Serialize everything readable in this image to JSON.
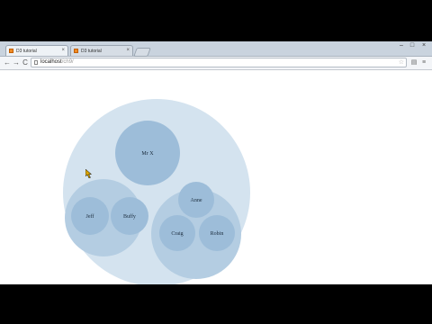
{
  "tabs": [
    {
      "title": "D3 tutorial",
      "active": true
    },
    {
      "title": "D3 tutorial",
      "active": false
    }
  ],
  "window_controls": {
    "minimize": "–",
    "maximize": "□",
    "close": "×"
  },
  "toolbar": {
    "back": "←",
    "forward": "→",
    "reload": "C",
    "url_host": "localhost",
    "url_path": "/ch9/",
    "star": "☆"
  },
  "colors": {
    "outer_fill": "#d4e3ef",
    "group_fill": "#b4cde2",
    "leaf_fill": "#9dbdd9",
    "tab_favicon": "#f08a24"
  },
  "chart_data": {
    "type": "pack",
    "root": {
      "name": "",
      "children": [
        {
          "name": "Mr X"
        },
        {
          "name": "",
          "children": [
            {
              "name": "Jeff"
            },
            {
              "name": "Buffy"
            }
          ]
        },
        {
          "name": "",
          "children": [
            {
              "name": "Anne"
            },
            {
              "name": "Craig"
            },
            {
              "name": "Robin"
            }
          ]
        }
      ]
    }
  }
}
